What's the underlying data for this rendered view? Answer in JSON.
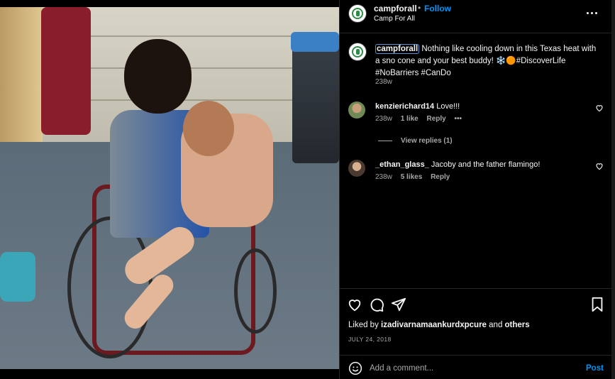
{
  "post": {
    "username": "campforall",
    "separator": "•",
    "follow_label": "Follow",
    "subtitle": "Camp For All",
    "more_icon": "more-horizontal-icon"
  },
  "caption": {
    "username": "campforall",
    "text": " Nothing like cooling down in this Texas heat with a sno cone and your best buddy! ❄️🟠#DiscoverLife #NoBarriers #CanDo",
    "time": "238w"
  },
  "comments": [
    {
      "username": "kenzierichard14",
      "text": "Love!!!",
      "time": "238w",
      "likes": "1 like",
      "reply": "Reply",
      "more": "•••"
    },
    {
      "username": "_ethan_glass_",
      "text": "Jacoby and the father flamingo!",
      "time": "238w",
      "likes": "5 likes",
      "reply": "Reply"
    }
  ],
  "view_replies": "View replies (1)",
  "actions": {
    "liked_by_prefix": "Liked by ",
    "liked_by_user": "izadivarnamaankurdxpcure",
    "liked_by_and": " and ",
    "liked_by_others": "others",
    "date": "JULY 24, 2018"
  },
  "add_comment": {
    "placeholder": "Add a comment...",
    "post_label": "Post"
  },
  "colors": {
    "accent": "#0095f6",
    "background": "#000000",
    "secondary_text": "#a8a8a8"
  }
}
